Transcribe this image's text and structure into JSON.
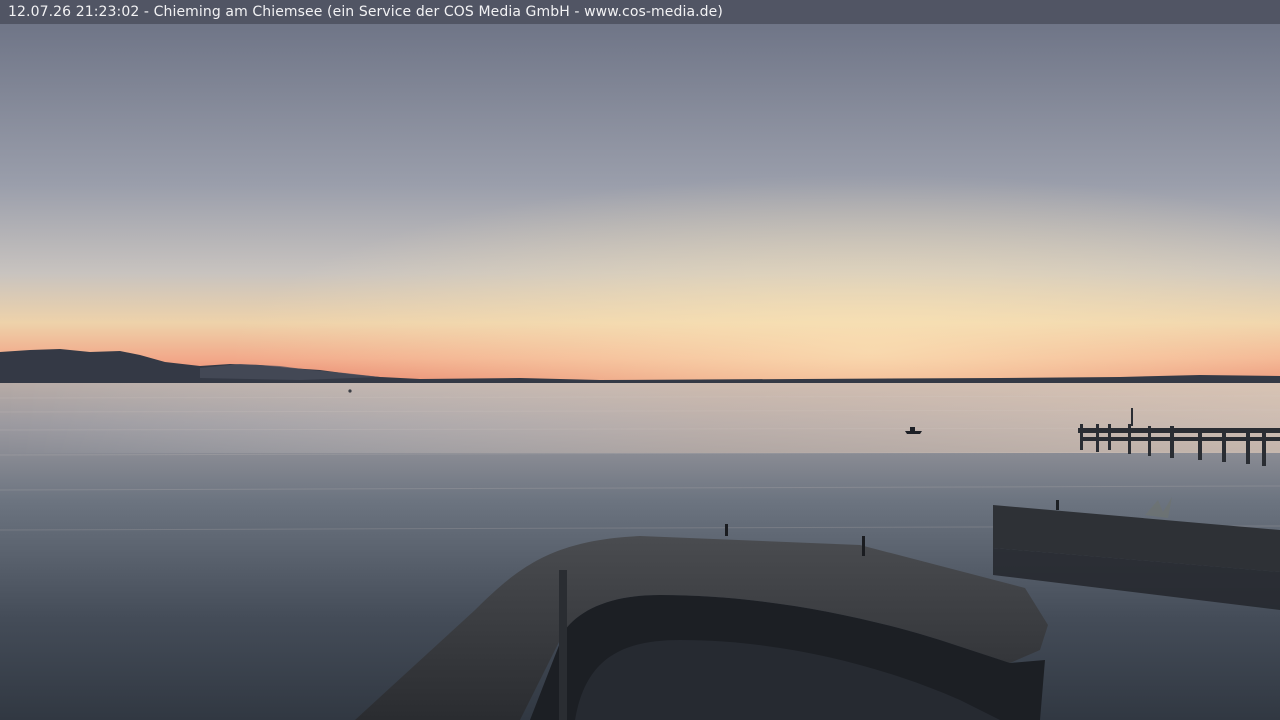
{
  "overlay": {
    "caption": "12.07.26 21:23:02 - Chieming am Chiemsee (ein Service der COS Media GmbH - www.cos-media.de)"
  },
  "colors": {
    "sky_top": "#6e7486",
    "sky_mid": "#a6a8b2",
    "sky_glow": "#f1d2a4",
    "horizon": "#ee8a6a",
    "water_far": "#c9b8aa",
    "water_near": "#3c4450",
    "silhouette": "#24282e"
  },
  "scene": {
    "elements": [
      "sky",
      "distant-mountains",
      "lake",
      "boat",
      "jetty",
      "harbor-wall",
      "breakwater"
    ]
  }
}
